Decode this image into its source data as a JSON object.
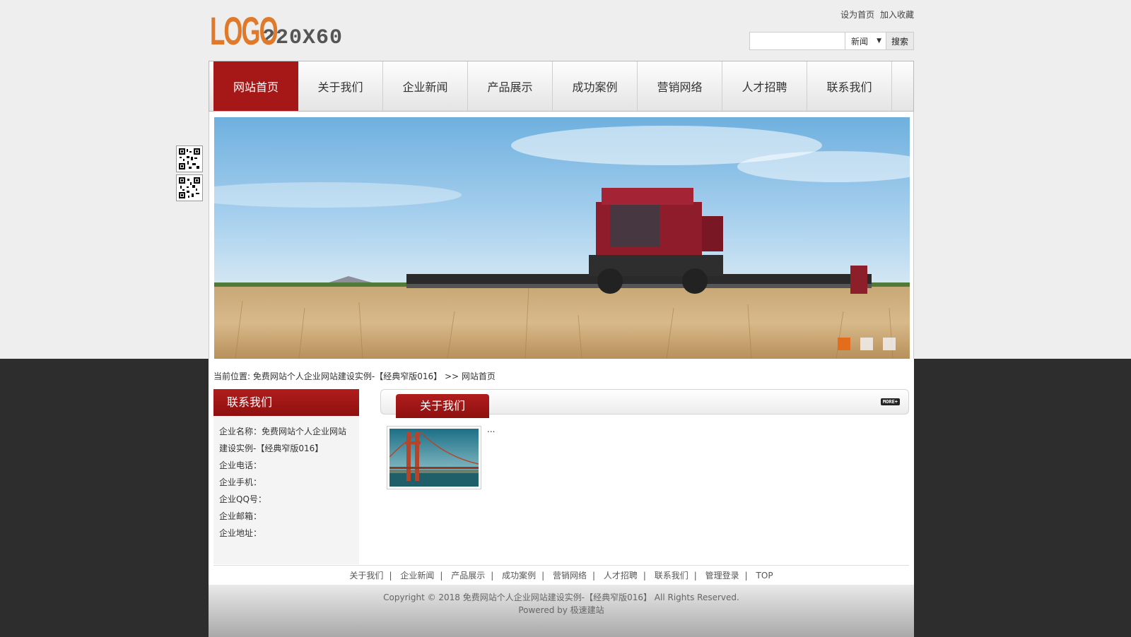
{
  "header": {
    "logo_word": "LOGO",
    "logo_size": "220X60",
    "set_home": "设为首页",
    "add_favorite": "加入收藏",
    "search": {
      "placeholder": "",
      "select_value": "新闻",
      "button": "搜索"
    }
  },
  "nav": {
    "items": [
      "网站首页",
      "关于我们",
      "企业新闻",
      "产品展示",
      "成功案例",
      "营销网络",
      "人才招聘",
      "联系我们"
    ],
    "active_index": 0
  },
  "banner": {
    "slide_count": 3,
    "active_slide": 0
  },
  "breadcrumb": {
    "label": "当前位置:",
    "site": "免费网站个人企业网站建设实例-【经典窄版016】",
    "sep": ">>",
    "current": "网站首页"
  },
  "sidebar": {
    "title": "联系我们",
    "name_label": "企业名称：",
    "name_value": "免费网站个人企业网站建设实例-【经典窄版016】",
    "phone": "企业电话：",
    "mobile": "企业手机：",
    "qq": "企业QQ号：",
    "email": "企业邮箱：",
    "address": "企业地址："
  },
  "main": {
    "title": "关于我们",
    "more": "MORE+",
    "excerpt": "..."
  },
  "footer": {
    "links": [
      "关于我们",
      "企业新闻",
      "产品展示",
      "成功案例",
      "营销网络",
      "人才招聘",
      "联系我们",
      "管理登录",
      "TOP"
    ],
    "copyright": "Copyright © 2018 免费网站个人企业网站建设实例-【经典窄版016】 All Rights Reserved.",
    "powered": "Powered by 极速建站"
  },
  "colors": {
    "brand_red": "#a61717",
    "logo_orange": "#e07a2a",
    "dot_active": "#e36d1c"
  }
}
